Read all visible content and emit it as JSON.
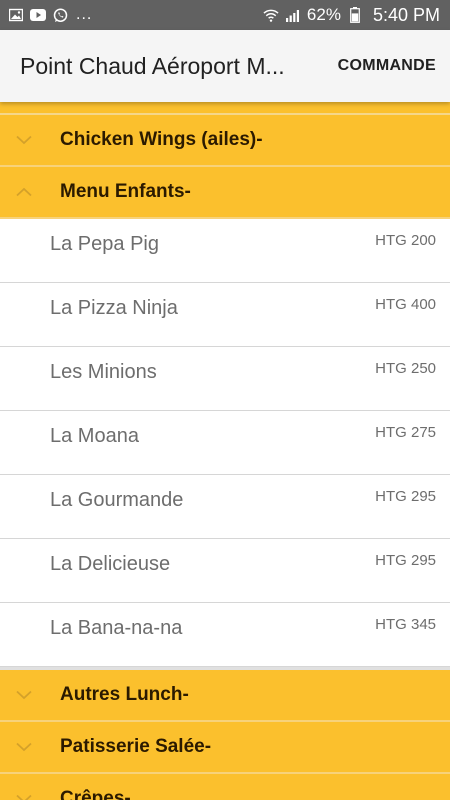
{
  "status_bar": {
    "icons": [
      "image-icon",
      "youtube-icon",
      "whatsapp-icon"
    ],
    "more": "...",
    "battery": "62%",
    "time": "5:40 PM"
  },
  "app_bar": {
    "title": "Point Chaud Aéroport M...",
    "order_label": "COMMANDE"
  },
  "colors": {
    "category_bg": "#fbc02d",
    "status_bar_bg": "#616161",
    "app_bar_bg": "#f5f5f5"
  },
  "categories": [
    {
      "label": "Chicken Wings (ailes)-",
      "expanded": false
    },
    {
      "label": "Menu Enfants-",
      "expanded": true,
      "items": [
        {
          "name": "La Pepa Pig",
          "price": "HTG 200"
        },
        {
          "name": "La Pizza Ninja",
          "price": "HTG 400"
        },
        {
          "name": "Les Minions",
          "price": "HTG 250"
        },
        {
          "name": "La Moana",
          "price": "HTG 275"
        },
        {
          "name": "La Gourmande",
          "price": "HTG 295"
        },
        {
          "name": "La Delicieuse",
          "price": "HTG 295"
        },
        {
          "name": "La Bana-na-na",
          "price": "HTG 345"
        }
      ]
    },
    {
      "label": "Autres Lunch-",
      "expanded": false
    },
    {
      "label": "Patisserie Salée-",
      "expanded": false
    },
    {
      "label": "Crêpes-",
      "expanded": false
    }
  ]
}
